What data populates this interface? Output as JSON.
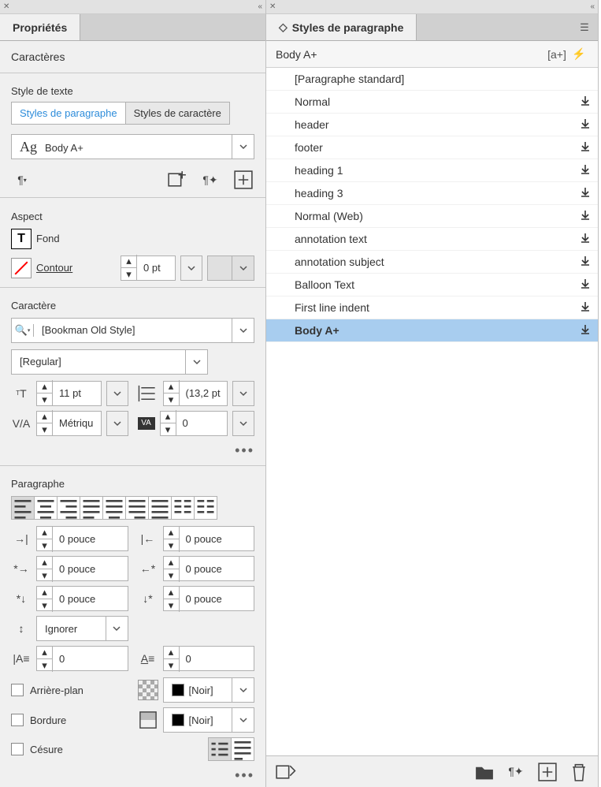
{
  "left": {
    "tab": "Propriétés",
    "characters": "Caractères",
    "textStyle": "Style de texte",
    "seg": {
      "para": "Styles de paragraphe",
      "char": "Styles de caractère"
    },
    "styleCombo": {
      "prefix": "Ag",
      "value": "Body A+"
    },
    "aspect": {
      "title": "Aspect",
      "fill": "Fond",
      "stroke": "Contour",
      "strokeWidth": "0 pt"
    },
    "character": {
      "title": "Caractère",
      "font": "[Bookman Old Style]",
      "weight": "[Regular]",
      "size": "11 pt",
      "leading": "(13,2 pt",
      "kerning": "Métriqu",
      "tracking": "0"
    },
    "paragraph": {
      "title": "Paragraphe",
      "indentLeft": "0 pouce",
      "indentRight": "0 pouce",
      "firstLine": "0 pouce",
      "lastLine": "0 pouce",
      "spaceBefore": "0 pouce",
      "spaceAfter": "0 pouce",
      "dropCap": "Ignorer",
      "gridLines": "0",
      "gridChars": "0",
      "bgLabel": "Arrière-plan",
      "borderLabel": "Bordure",
      "hyphenLabel": "Césure",
      "black": "[Noir]"
    }
  },
  "right": {
    "tab": "Styles de paragraphe",
    "currentStyle": "Body A+",
    "styles": [
      {
        "name": "[Paragraphe standard]",
        "dl": false,
        "indent": true
      },
      {
        "name": "Normal",
        "dl": true
      },
      {
        "name": "header",
        "dl": true
      },
      {
        "name": "footer",
        "dl": true
      },
      {
        "name": "heading 1",
        "dl": true
      },
      {
        "name": "heading 3",
        "dl": true
      },
      {
        "name": "Normal (Web)",
        "dl": true
      },
      {
        "name": "annotation text",
        "dl": true
      },
      {
        "name": "annotation subject",
        "dl": true
      },
      {
        "name": "Balloon Text",
        "dl": true
      },
      {
        "name": "First line indent",
        "dl": true
      },
      {
        "name": "Body A+",
        "dl": true,
        "selected": true
      }
    ]
  }
}
